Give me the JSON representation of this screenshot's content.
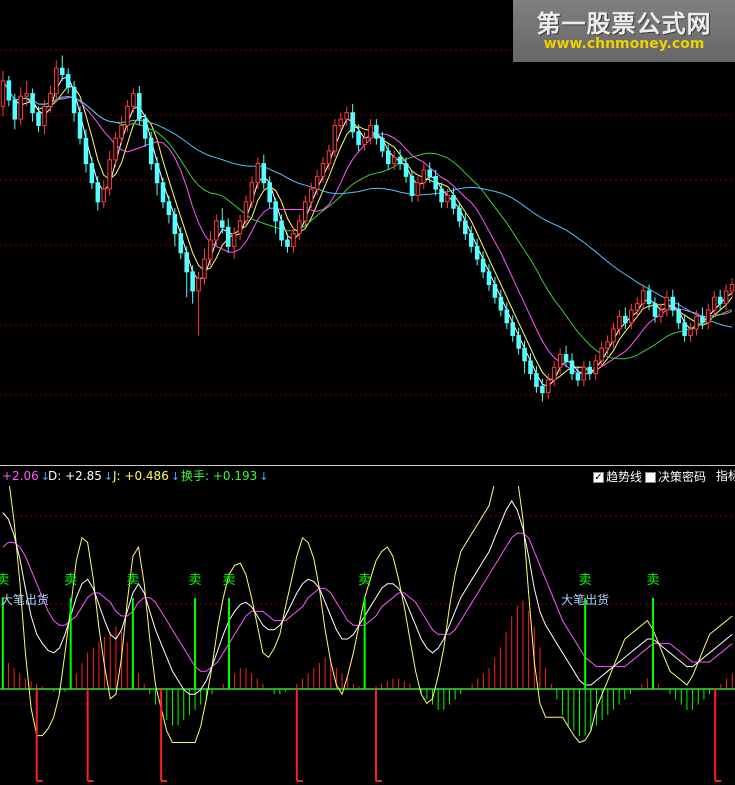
{
  "colors": {
    "up": "#ff3b3b",
    "down": "#54ffff",
    "grid": "#7a0000",
    "sell": "#00ff00",
    "buy": "#ff2020",
    "ma_white": "#ffffff",
    "ma_yellow": "#ffff66",
    "ma_magenta": "#ff55ff",
    "ma_green": "#3ccc3c",
    "ma_blue": "#4fc3f7"
  },
  "indicator_bar": {
    "k_value": "+2.06",
    "d_label": "D:",
    "d_value": "+2.85",
    "j_label": "J:",
    "j_value": "+0.486",
    "turnover_label": "换手:",
    "turnover_value": "+0.193",
    "arrow": "↓",
    "trend_line_label": "趋势线",
    "trend_line_checked": true,
    "decision_code_label": "决策密码",
    "decision_code_checked": false,
    "index_label": "指标"
  },
  "watermark": {
    "title": "第一股票公式网",
    "url": "www.chnmoney.com"
  },
  "signals": {
    "sell_label": "卖",
    "big_sell_label": "大笔出货"
  },
  "chart_data": {
    "type": "candlestick",
    "candles": [
      [
        270,
        290,
        262,
        298
      ],
      [
        290,
        275,
        270,
        294
      ],
      [
        275,
        260,
        252,
        280
      ],
      [
        260,
        278,
        255,
        285
      ],
      [
        278,
        280,
        270,
        290
      ],
      [
        280,
        265,
        258,
        284
      ],
      [
        265,
        255,
        250,
        270
      ],
      [
        255,
        270,
        248,
        275
      ],
      [
        270,
        280,
        265,
        286
      ],
      [
        280,
        300,
        274,
        306
      ],
      [
        300,
        295,
        290,
        310
      ],
      [
        295,
        285,
        280,
        300
      ],
      [
        285,
        265,
        258,
        290
      ],
      [
        265,
        245,
        240,
        270
      ],
      [
        245,
        225,
        218,
        252
      ],
      [
        225,
        210,
        205,
        230
      ],
      [
        210,
        195,
        188,
        215
      ],
      [
        195,
        205,
        190,
        212
      ],
      [
        205,
        228,
        200,
        235
      ],
      [
        228,
        245,
        222,
        250
      ],
      [
        245,
        255,
        240,
        262
      ],
      [
        255,
        270,
        250,
        275
      ],
      [
        270,
        280,
        265,
        284
      ],
      [
        280,
        260,
        255,
        286
      ],
      [
        260,
        245,
        238,
        264
      ],
      [
        245,
        225,
        220,
        250
      ],
      [
        225,
        210,
        200,
        230
      ],
      [
        210,
        195,
        190,
        214
      ],
      [
        195,
        185,
        178,
        200
      ],
      [
        185,
        170,
        160,
        190
      ],
      [
        170,
        155,
        150,
        175
      ],
      [
        155,
        140,
        120,
        160
      ],
      [
        140,
        125,
        115,
        145
      ],
      [
        125,
        135,
        90,
        140
      ],
      [
        135,
        150,
        130,
        158
      ],
      [
        150,
        165,
        145,
        172
      ],
      [
        165,
        180,
        160,
        185
      ],
      [
        180,
        175,
        170,
        190
      ],
      [
        175,
        160,
        155,
        182
      ],
      [
        160,
        170,
        150,
        175
      ],
      [
        170,
        180,
        165,
        185
      ],
      [
        180,
        195,
        175,
        200
      ],
      [
        195,
        210,
        190,
        215
      ],
      [
        210,
        225,
        205,
        230
      ],
      [
        225,
        210,
        205,
        232
      ],
      [
        210,
        195,
        190,
        215
      ],
      [
        195,
        180,
        170,
        198
      ],
      [
        180,
        165,
        160,
        185
      ],
      [
        165,
        160,
        155,
        170
      ],
      [
        160,
        170,
        155,
        175
      ],
      [
        170,
        180,
        165,
        185
      ],
      [
        180,
        195,
        175,
        200
      ],
      [
        195,
        205,
        190,
        210
      ],
      [
        205,
        215,
        200,
        220
      ],
      [
        215,
        225,
        210,
        230
      ],
      [
        225,
        235,
        220,
        240
      ],
      [
        235,
        255,
        230,
        260
      ],
      [
        255,
        260,
        250,
        265
      ],
      [
        260,
        265,
        255,
        270
      ],
      [
        265,
        250,
        245,
        272
      ],
      [
        250,
        240,
        235,
        256
      ],
      [
        240,
        245,
        235,
        250
      ],
      [
        245,
        255,
        240,
        260
      ],
      [
        255,
        245,
        240,
        260
      ],
      [
        245,
        235,
        230,
        250
      ],
      [
        235,
        225,
        220,
        240
      ],
      [
        225,
        230,
        220,
        235
      ],
      [
        230,
        225,
        220,
        236
      ],
      [
        225,
        215,
        210,
        230
      ],
      [
        215,
        200,
        195,
        220
      ],
      [
        200,
        210,
        195,
        215
      ],
      [
        210,
        220,
        205,
        225
      ],
      [
        220,
        215,
        210,
        226
      ],
      [
        215,
        205,
        200,
        220
      ],
      [
        205,
        195,
        190,
        210
      ],
      [
        195,
        200,
        190,
        205
      ],
      [
        200,
        190,
        185,
        206
      ],
      [
        190,
        180,
        175,
        195
      ],
      [
        180,
        170,
        165,
        186
      ],
      [
        170,
        160,
        155,
        176
      ],
      [
        160,
        150,
        145,
        166
      ],
      [
        150,
        140,
        135,
        156
      ],
      [
        140,
        130,
        125,
        146
      ],
      [
        130,
        120,
        115,
        136
      ],
      [
        120,
        110,
        105,
        126
      ],
      [
        110,
        100,
        95,
        116
      ],
      [
        100,
        90,
        85,
        106
      ],
      [
        90,
        80,
        75,
        96
      ],
      [
        80,
        70,
        60,
        86
      ],
      [
        70,
        60,
        55,
        76
      ],
      [
        60,
        50,
        45,
        66
      ],
      [
        50,
        45,
        38,
        56
      ],
      [
        45,
        55,
        40,
        60
      ],
      [
        55,
        65,
        50,
        70
      ],
      [
        65,
        75,
        60,
        80
      ],
      [
        75,
        70,
        65,
        82
      ],
      [
        70,
        60,
        55,
        76
      ],
      [
        60,
        55,
        50,
        66
      ],
      [
        55,
        65,
        50,
        70
      ],
      [
        65,
        60,
        55,
        70
      ],
      [
        60,
        70,
        55,
        75
      ],
      [
        70,
        80,
        65,
        85
      ],
      [
        80,
        85,
        75,
        90
      ],
      [
        85,
        95,
        80,
        100
      ],
      [
        95,
        105,
        90,
        110
      ],
      [
        105,
        100,
        95,
        112
      ],
      [
        100,
        110,
        95,
        115
      ],
      [
        110,
        115,
        105,
        120
      ],
      [
        115,
        125,
        110,
        130
      ],
      [
        125,
        115,
        110,
        130
      ],
      [
        115,
        105,
        100,
        120
      ],
      [
        105,
        110,
        100,
        115
      ],
      [
        110,
        120,
        105,
        125
      ],
      [
        120,
        110,
        105,
        126
      ],
      [
        110,
        100,
        95,
        116
      ],
      [
        100,
        90,
        85,
        106
      ],
      [
        90,
        95,
        85,
        100
      ],
      [
        95,
        105,
        90,
        110
      ],
      [
        105,
        100,
        95,
        112
      ],
      [
        100,
        110,
        95,
        115
      ],
      [
        110,
        120,
        105,
        125
      ],
      [
        120,
        115,
        110,
        126
      ],
      [
        115,
        125,
        110,
        130
      ],
      [
        125,
        130,
        120,
        135
      ]
    ],
    "price_min": 0,
    "price_max": 330,
    "sub_series": {
      "k": [
        95,
        92,
        85,
        75,
        62,
        50,
        42,
        38,
        35,
        34,
        36,
        42,
        50,
        58,
        64,
        66,
        62,
        55,
        48,
        42,
        40,
        44,
        52,
        60,
        64,
        60,
        52,
        44,
        38,
        32,
        26,
        22,
        18,
        16,
        16,
        18,
        22,
        28,
        35,
        42,
        48,
        52,
        55,
        56,
        54,
        50,
        46,
        44,
        44,
        46,
        50,
        55,
        60,
        64,
        66,
        65,
        62,
        56,
        50,
        44,
        40,
        40,
        42,
        46,
        50,
        54,
        58,
        62,
        64,
        64,
        62,
        58,
        52,
        46,
        40,
        36,
        34,
        36,
        40,
        46,
        52,
        58,
        62,
        66,
        70,
        74,
        78,
        84,
        90,
        96,
        100,
        96,
        88,
        76,
        62,
        52,
        46,
        42,
        38,
        34,
        30,
        26,
        22,
        20,
        20,
        22,
        24,
        26,
        28,
        30,
        32,
        34,
        36,
        38,
        40,
        40,
        38,
        36,
        34,
        32,
        30,
        28,
        28,
        30,
        32,
        34,
        36,
        38,
        40,
        42
      ],
      "d": [
        80,
        82,
        82,
        80,
        76,
        70,
        64,
        58,
        52,
        48,
        46,
        46,
        48,
        50,
        54,
        58,
        60,
        60,
        58,
        56,
        52,
        50,
        50,
        52,
        56,
        58,
        58,
        56,
        52,
        48,
        44,
        40,
        36,
        32,
        28,
        26,
        26,
        28,
        30,
        34,
        38,
        42,
        46,
        50,
        52,
        52,
        52,
        50,
        48,
        48,
        48,
        50,
        52,
        54,
        58,
        60,
        62,
        62,
        60,
        56,
        52,
        48,
        46,
        46,
        46,
        48,
        50,
        54,
        56,
        58,
        60,
        60,
        58,
        56,
        52,
        48,
        44,
        42,
        42,
        42,
        44,
        48,
        52,
        56,
        60,
        64,
        68,
        72,
        76,
        80,
        84,
        86,
        86,
        84,
        78,
        72,
        66,
        60,
        54,
        48,
        44,
        40,
        36,
        32,
        30,
        28,
        28,
        28,
        28,
        28,
        28,
        30,
        32,
        34,
        36,
        38,
        38,
        38,
        38,
        36,
        34,
        32,
        30,
        30,
        30,
        30,
        32,
        34,
        36,
        38
      ],
      "bars": [
        12,
        10,
        8,
        6,
        4,
        3,
        2,
        1,
        0,
        -1,
        -2,
        -1,
        2,
        6,
        10,
        14,
        16,
        18,
        20,
        22,
        24,
        22,
        18,
        12,
        6,
        2,
        -2,
        -6,
        -10,
        -12,
        -14,
        -14,
        -12,
        -10,
        -8,
        -6,
        -4,
        -2,
        0,
        2,
        4,
        6,
        8,
        8,
        6,
        4,
        2,
        0,
        -2,
        -2,
        -1,
        0,
        2,
        4,
        6,
        8,
        10,
        12,
        10,
        8,
        6,
        4,
        2,
        1,
        0,
        0,
        1,
        2,
        3,
        4,
        4,
        3,
        2,
        0,
        -2,
        -4,
        -6,
        -8,
        -8,
        -6,
        -4,
        -2,
        0,
        2,
        4,
        6,
        8,
        12,
        16,
        22,
        28,
        32,
        34,
        30,
        24,
        16,
        8,
        2,
        -4,
        -10,
        -14,
        -16,
        -18,
        -18,
        -16,
        -14,
        -12,
        -10,
        -8,
        -6,
        -4,
        -2,
        0,
        2,
        4,
        4,
        2,
        0,
        -2,
        -4,
        -6,
        -8,
        -8,
        -6,
        -4,
        -2,
        0,
        2,
        4,
        6,
        8,
        10
      ],
      "sell_marks": [
        0,
        12,
        23,
        34,
        40,
        64,
        103,
        115,
        136
      ],
      "big_sell_marks": [
        0,
        103
      ],
      "buy_marks": [
        6,
        15,
        28,
        52,
        66,
        126,
        139
      ]
    }
  }
}
